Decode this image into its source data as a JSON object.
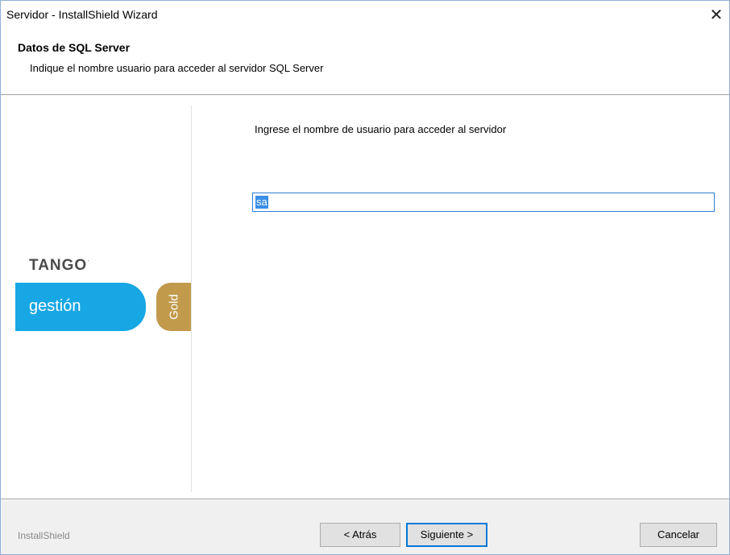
{
  "window": {
    "title": "Servidor - InstallShield Wizard",
    "close_glyph": "✕"
  },
  "header": {
    "title": "Datos de SQL Server",
    "subtitle": "Indique el nombre usuario para acceder al servidor SQL Server"
  },
  "branding": {
    "logo": "TANGO",
    "logo_mark": "·",
    "product": "gestión",
    "edition": "Gold",
    "colors": {
      "product": "#17a7e4",
      "edition": "#c19a4b"
    }
  },
  "main": {
    "prompt": "Ingrese el nombre de usuario para acceder al servidor",
    "username_value": "sa"
  },
  "footer": {
    "brand": "InstallShield",
    "back_label": "< Atrás",
    "next_label": "Siguiente >",
    "cancel_label": "Cancelar"
  }
}
